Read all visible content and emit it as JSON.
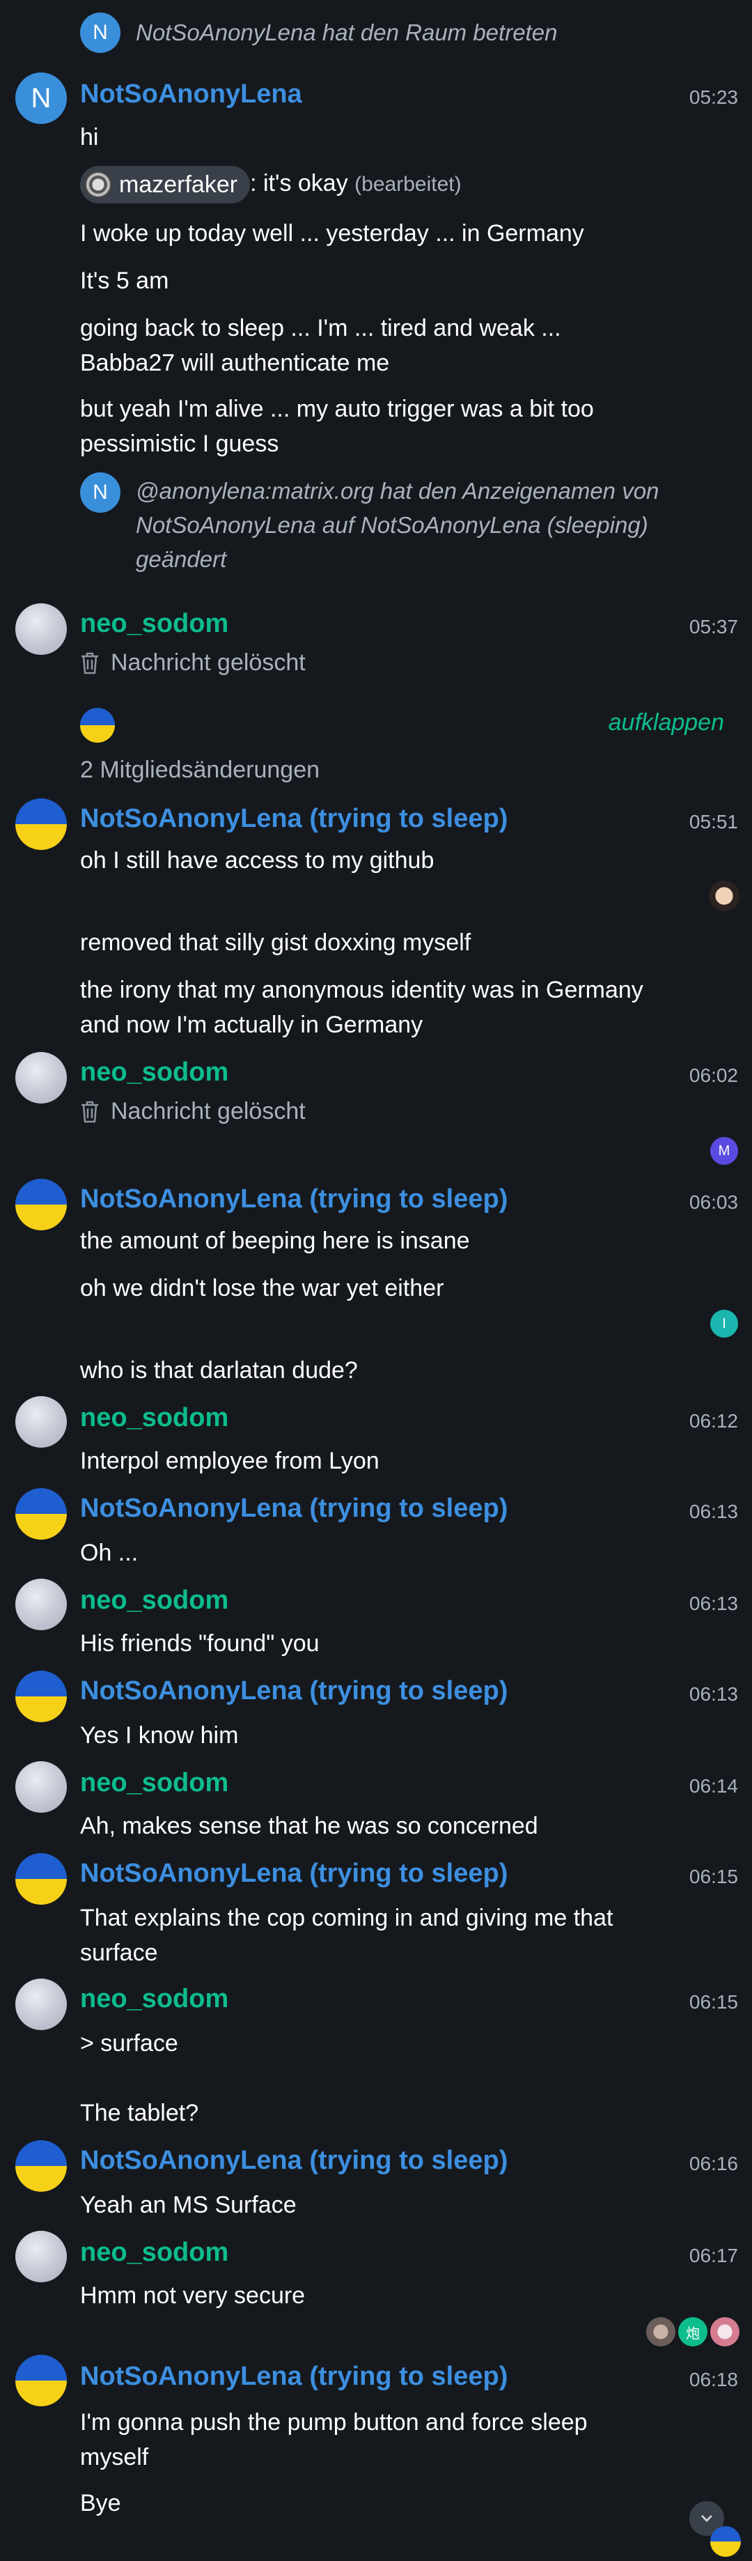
{
  "events": {
    "join": {
      "avatar_letter": "N",
      "text": "NotSoAnonyLena hat den Raum betreten"
    },
    "m1": {
      "avatar_letter": "N",
      "sender": "NotSoAnonyLena",
      "time": "05:23",
      "lines": [
        "hi"
      ],
      "pill_name": "mazerfaker",
      "reply_text": ": it's okay",
      "edited": "(bearbeitet)",
      "more": [
        "I woke up today well ... yesterday ... in Germany",
        "It's 5 am",
        "going back to sleep ... I'm ... tired and weak ... Babba27 will authenticate me",
        "but yeah I'm alive ... my auto trigger was a bit too pessimistic I guess"
      ],
      "sys_letter": "N",
      "sys_text": "@anonylena:matrix.org hat den Anzeigenamen von NotSoAnonyLena auf NotSoAnonyLena (sleeping) geändert"
    },
    "m2": {
      "sender": "neo_sodom",
      "time": "05:37",
      "deleted": "Nachricht gelöscht"
    },
    "collapsed": {
      "expand_label": "aufklappen",
      "summary": "2 Mitgliedsänderungen"
    },
    "m3": {
      "sender": "NotSoAnonyLena (trying to sleep)",
      "time": "05:51",
      "lines": [
        "oh I still have access to my github",
        "removed that silly gist doxxing myself",
        "the irony that my anonymous identity was in Germany and now I'm actually in Germany"
      ]
    },
    "m4": {
      "sender": "neo_sodom",
      "time": "06:02",
      "deleted": "Nachricht gelöscht",
      "receipt_letter": "M"
    },
    "m5": {
      "sender": "NotSoAnonyLena (trying to sleep)",
      "time": "06:03",
      "lines": [
        "the amount of beeping here is insane",
        "oh we didn't lose the war yet either",
        "who is that darlatan dude?"
      ],
      "receipt_letter": "I"
    },
    "m6": {
      "sender": "neo_sodom",
      "time": "06:12",
      "text": "Interpol employee from Lyon"
    },
    "m7": {
      "sender": "NotSoAnonyLena (trying to sleep)",
      "time": "06:13",
      "text": "Oh ..."
    },
    "m8": {
      "sender": "neo_sodom",
      "time": "06:13",
      "text": "His friends \"found\" you"
    },
    "m9": {
      "sender": "NotSoAnonyLena (trying to sleep)",
      "time": "06:13",
      "text": "Yes I know him"
    },
    "m10": {
      "sender": "neo_sodom",
      "time": "06:14",
      "text": "Ah, makes sense that he was so concerned"
    },
    "m11": {
      "sender": "NotSoAnonyLena (trying to sleep)",
      "time": "06:15",
      "text": "That explains the cop coming in and giving me that surface"
    },
    "m12": {
      "sender": "neo_sodom",
      "time": "06:15",
      "lines": [
        "> surface",
        "The tablet?"
      ]
    },
    "m13": {
      "sender": "NotSoAnonyLena (trying to sleep)",
      "time": "06:16",
      "text": "Yeah an MS Surface"
    },
    "m14": {
      "sender": "neo_sodom",
      "time": "06:17",
      "text": "Hmm not very secure",
      "receipt_glyph": "炮"
    },
    "m15": {
      "sender": "NotSoAnonyLena (trying to sleep)",
      "time": "06:18",
      "lines": [
        "I'm gonna push the pump button and force sleep myself",
        "Bye"
      ]
    }
  },
  "colors": {
    "background": "#15191e",
    "lena": "#3d8fe0",
    "neo": "#0dbd8b",
    "muted": "#a9b2bc"
  },
  "icons": {
    "delete": "trash-icon",
    "scroll": "chevron-down-icon"
  }
}
